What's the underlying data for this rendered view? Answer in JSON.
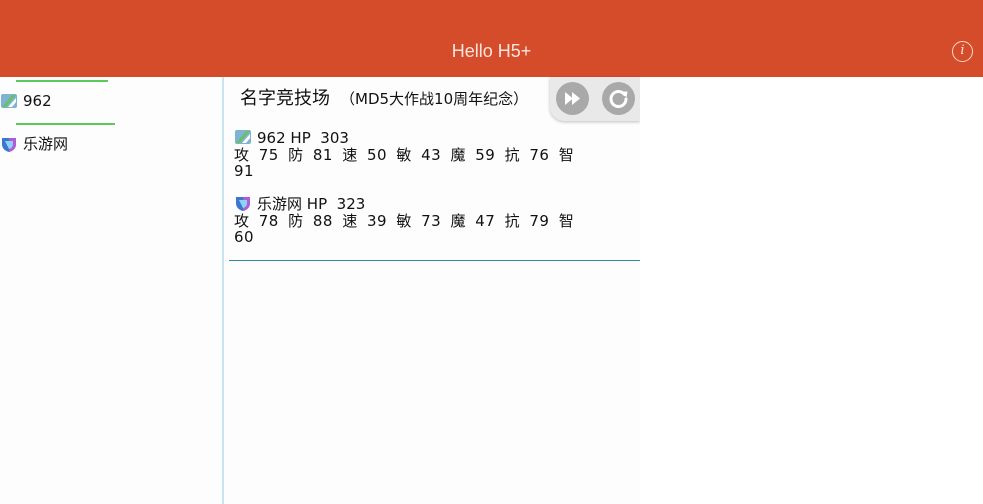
{
  "header": {
    "title": "Hello H5+",
    "info_icon": "info-icon",
    "color": "#d54c2b"
  },
  "players": [
    {
      "name": "962",
      "avatar": "avatar-icon-green-stripe"
    },
    {
      "name": "乐游网",
      "avatar": "avatar-icon-blue-shield"
    }
  ],
  "arena": {
    "title": "名字竞技场",
    "subtitle": "（MD5大作战10周年纪念）",
    "buttons": [
      "fast-forward-icon",
      "refresh-icon"
    ],
    "stats": [
      {
        "name": "962",
        "hp_label": "HP",
        "hp": "303",
        "line1": "攻 75 防 81 速 50 敏 43 魔 59 抗 76 智",
        "line2": "91"
      },
      {
        "name": "乐游网",
        "hp_label": "HP",
        "hp": "323",
        "line1": "攻 78 防 88 速 39 敏 73 魔 47 抗 79 智",
        "line2": "60"
      }
    ]
  }
}
